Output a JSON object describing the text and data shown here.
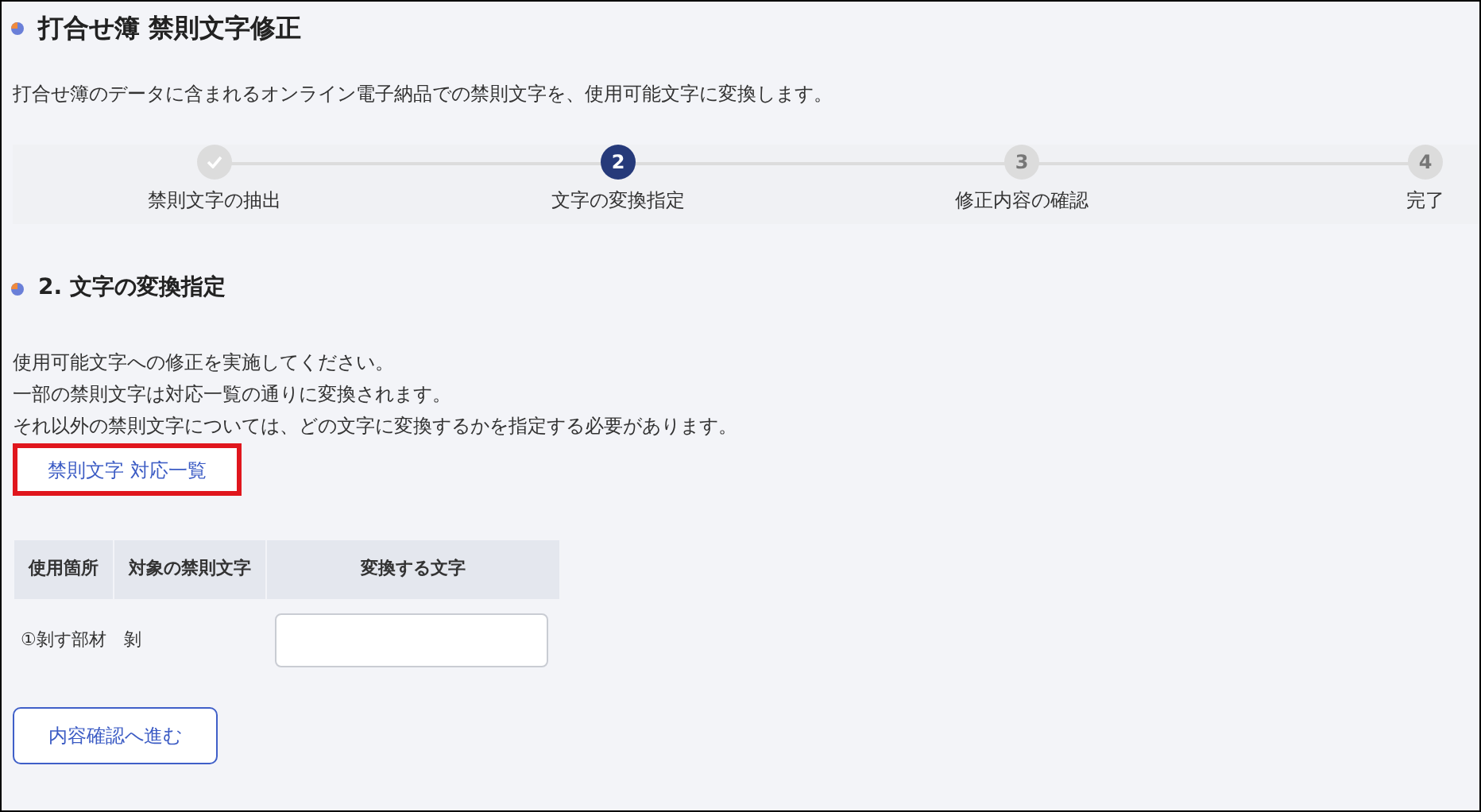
{
  "page": {
    "title": "打合せ簿 禁則文字修正",
    "description": "打合せ簿のデータに含まれるオンライン電子納品での禁則文字を、使用可能文字に変換します。"
  },
  "steps": [
    {
      "kind": "done",
      "label": "禁則文字の抽出",
      "selected": false
    },
    {
      "kind": "current",
      "number": "2",
      "label": "文字の変換指定",
      "selected": true
    },
    {
      "kind": "pending",
      "number": "3",
      "label": "修正内容の確認",
      "selected": false
    },
    {
      "kind": "pending",
      "number": "4",
      "label": "完了",
      "selected": false
    }
  ],
  "section": {
    "title": "2. 文字の変換指定",
    "instructions": [
      "使用可能文字への修正を実施してください。",
      "一部の禁則文字は対応一覧の通りに変換されます。",
      "それ以外の禁則文字については、どの文字に変換するかを指定する必要があります。"
    ],
    "link": {
      "label": "禁則文字 対応一覧",
      "highlighted": true
    }
  },
  "table": {
    "columns": [
      "使用箇所",
      "対象の禁則文字",
      "変換する文字"
    ],
    "rows": [
      {
        "location": "①剝す部材",
        "character": "剝"
      }
    ]
  },
  "buttons": [
    {
      "label": "内容確認へ進む"
    }
  ]
}
